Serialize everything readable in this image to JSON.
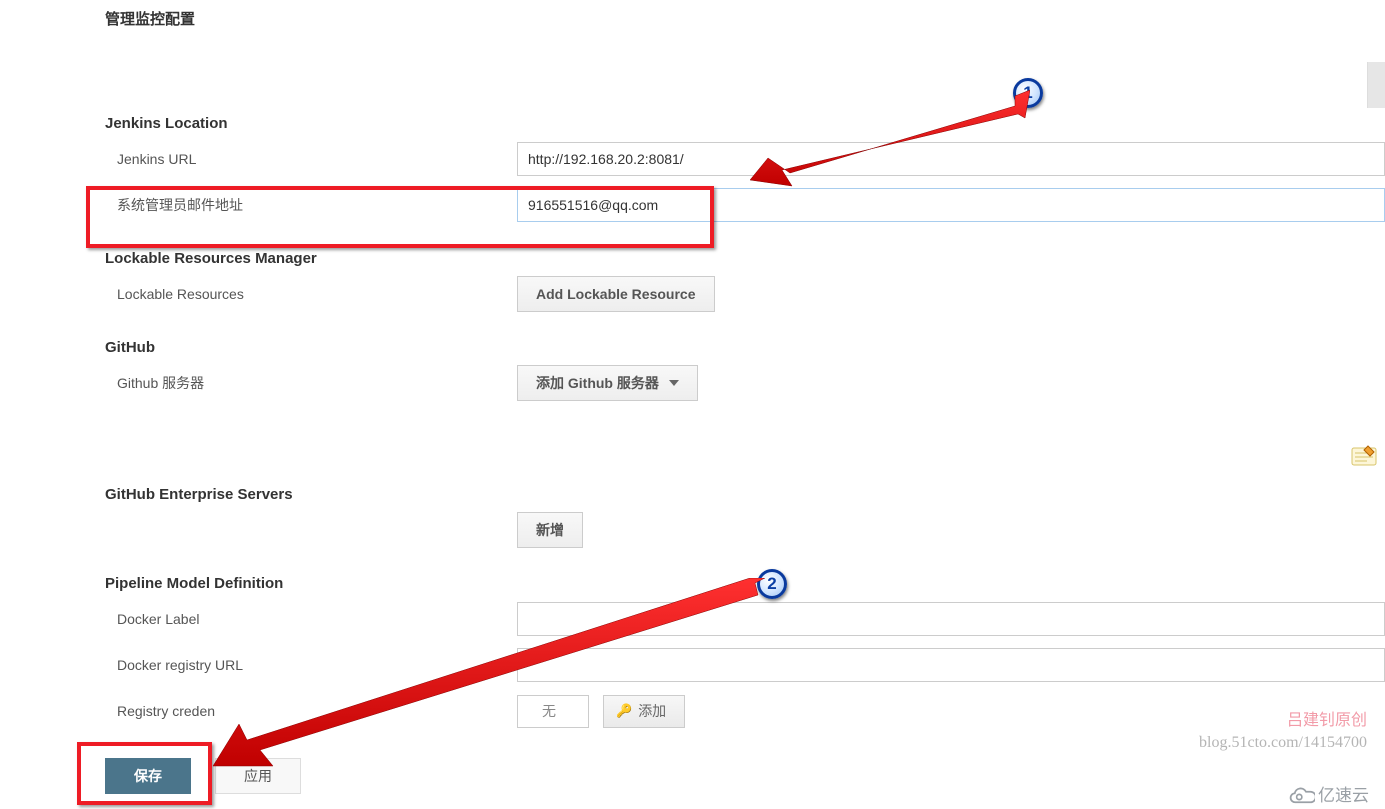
{
  "sections": {
    "monitor_title": "管理监控配置",
    "jenkins_location": {
      "title": "Jenkins Location",
      "url_label": "Jenkins URL",
      "url_value": "http://192.168.20.2:8081/",
      "admin_email_label": "系统管理员邮件地址",
      "admin_email_value": "916551516@qq.com"
    },
    "lockable": {
      "title": "Lockable Resources Manager",
      "label": "Lockable Resources",
      "button": "Add Lockable Resource"
    },
    "github": {
      "title": "GitHub",
      "server_label": "Github 服务器",
      "add_server_button": "添加 Github 服务器"
    },
    "github_enterprise": {
      "title": "GitHub Enterprise Servers",
      "add_button": "新增"
    },
    "pipeline": {
      "title": "Pipeline Model Definition",
      "docker_label": "Docker Label",
      "docker_label_value": "",
      "docker_registry_label": "Docker registry URL",
      "docker_registry_value": "",
      "registry_cred_label": "Registry creden",
      "none_option": "无",
      "add_button": "添加"
    }
  },
  "buttons": {
    "save": "保存",
    "apply": "应用"
  },
  "balloons": {
    "one": "1",
    "two": "2"
  },
  "watermark": {
    "line1": "吕建钊原创",
    "line2": "blog.51cto.com/14154700",
    "brand": "亿速云"
  }
}
